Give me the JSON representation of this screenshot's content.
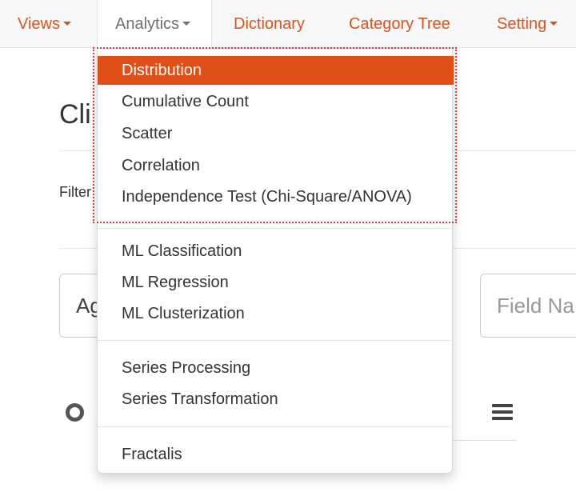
{
  "navbar": {
    "items": [
      {
        "label": "Views",
        "has_caret": true
      },
      {
        "label": "Analytics",
        "has_caret": true,
        "active": true
      },
      {
        "label": "Dictionary",
        "has_caret": false
      },
      {
        "label": "Category Tree",
        "has_caret": false
      },
      {
        "label": "Setting",
        "has_caret": true
      }
    ]
  },
  "background": {
    "title_partial": "Cli",
    "filter_label_partial": "Filter",
    "input_left_value_partial": "Ag",
    "input_right_placeholder_partial": "Field Na",
    "icons": [
      "circle-icon",
      "hamburger-menu-icon"
    ]
  },
  "analytics_menu": {
    "groups": [
      [
        "Distribution",
        "Cumulative Count",
        "Scatter",
        "Correlation",
        "Independence Test (Chi-Square/ANOVA)"
      ],
      [
        "ML Classification",
        "ML Regression",
        "ML Clusterization"
      ],
      [
        "Series Processing",
        "Series Transformation"
      ],
      [
        "Fractalis"
      ]
    ],
    "highlighted_item": "Distribution"
  },
  "colors": {
    "accent": "#e0521c",
    "highlight_bg": "#e04f18",
    "annotation_outline": "#e43a3a"
  }
}
